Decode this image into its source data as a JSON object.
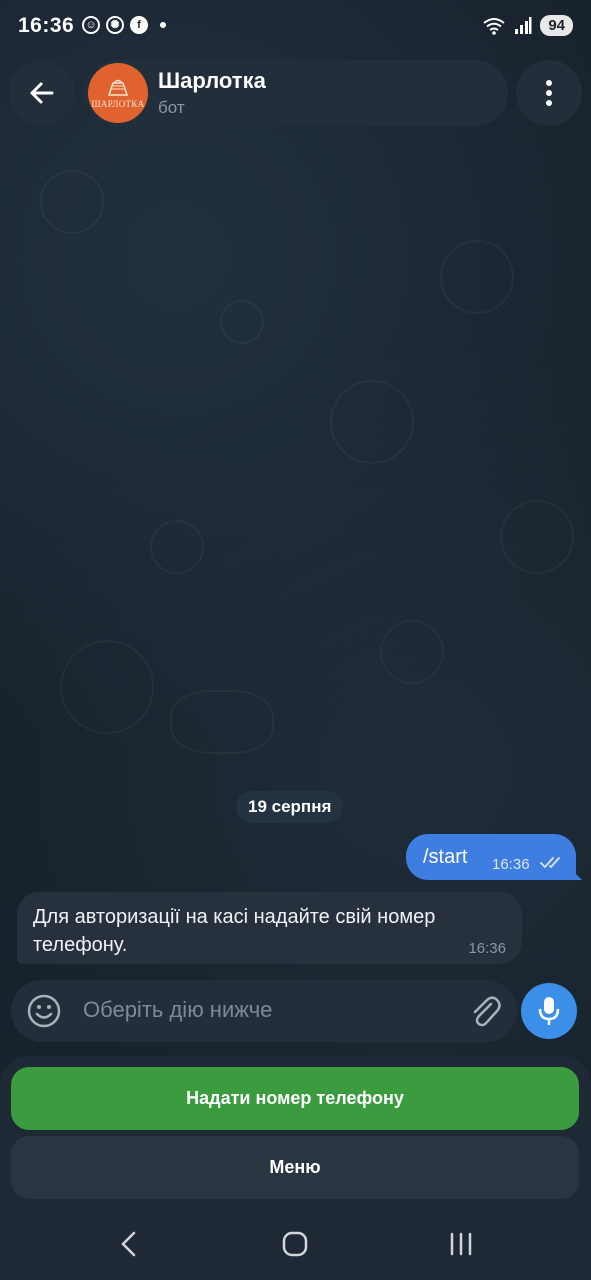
{
  "status_bar": {
    "time": "16:36",
    "battery": "94"
  },
  "header": {
    "title": "Шарлотка",
    "subtitle": "бот",
    "avatar_text": "ШАРЛОТКА"
  },
  "messages": {
    "date": "19 серпня",
    "outgoing": {
      "text": "/start",
      "time": "16:36"
    },
    "incoming": {
      "text": "Для авторизації на касі надайте свій номер телефону.",
      "time": "16:36"
    }
  },
  "composer": {
    "placeholder": "Оберіть дію нижче"
  },
  "keyboard": {
    "share_phone": "Надати номер телефону",
    "menu": "Меню"
  },
  "colors": {
    "accent": "#3e7ee0",
    "green_button": "#3a9c3f",
    "avatar_bg": "#e0632f"
  }
}
